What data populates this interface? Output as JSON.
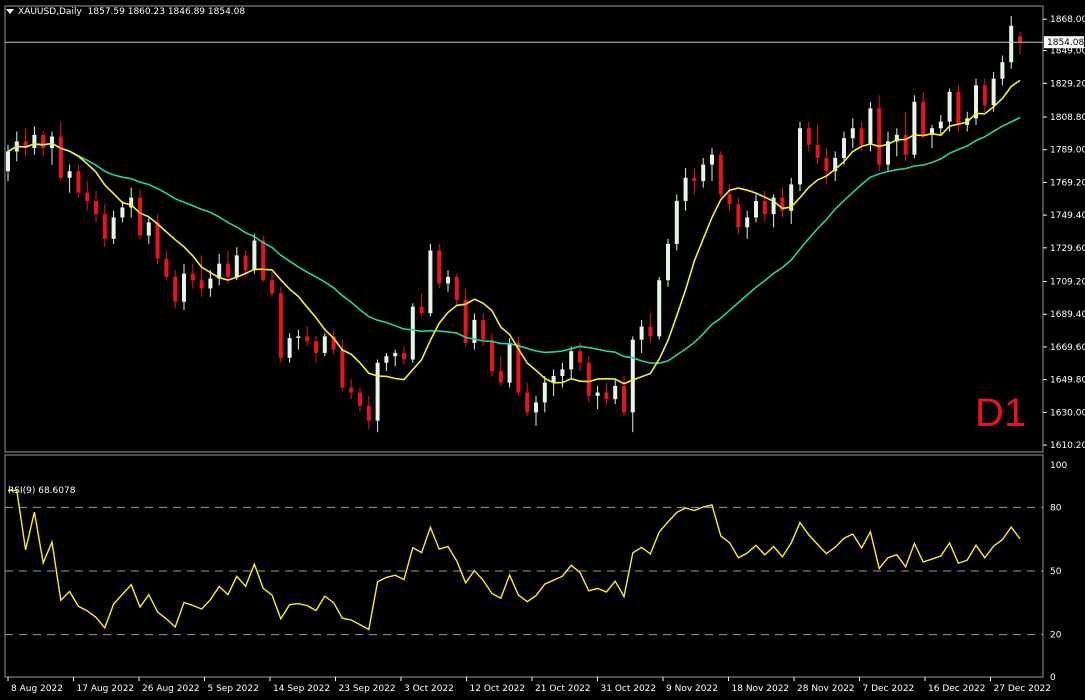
{
  "header": {
    "symbol": "XAUUSD,Daily",
    "ohlc": "1857.59 1860.23 1846.89 1854.08",
    "dropdown_icon": "triangle-down-icon"
  },
  "timeframe_badge": "D1",
  "rsi_header": "RSI(9) 68.6078",
  "colors": {
    "background": "#000000",
    "bull_candle": "#e6f5e6",
    "bear_candle": "#e8141c",
    "ma_fast": "#f5ee3a",
    "ma_slow": "#26d3a0",
    "rsi_line": "#ffeb2a",
    "grid": "#9a9a9a",
    "d1_text": "#e8141c"
  },
  "chart_data": [
    {
      "type": "candlestick",
      "symbol": "XAUUSD",
      "timeframe": "Daily",
      "y_ticks": [
        1868.0,
        1849.0,
        1829.2,
        1808.8,
        1789.0,
        1769.2,
        1749.4,
        1729.6,
        1709.2,
        1689.4,
        1669.6,
        1649.8,
        1630.0,
        1610.2
      ],
      "ylim": [
        1606,
        1876
      ],
      "current_price": 1854.08,
      "current_price_label": "1854.08",
      "x_labels": [
        "8 Aug 2022",
        "17 Aug 2022",
        "26 Aug 2022",
        "5 Sep 2022",
        "14 Sep 2022",
        "23 Sep 2022",
        "3 Oct 2022",
        "12 Oct 2022",
        "21 Oct 2022",
        "31 Oct 2022",
        "9 Nov 2022",
        "18 Nov 2022",
        "28 Nov 2022",
        "7 Dec 2022",
        "16 Dec 2022",
        "27 Dec 2022"
      ],
      "candles": [
        [
          1776,
          1792,
          1770,
          1788
        ],
        [
          1788,
          1800,
          1782,
          1794
        ],
        [
          1794,
          1802,
          1785,
          1790
        ],
        [
          1790,
          1803,
          1786,
          1798
        ],
        [
          1798,
          1800,
          1785,
          1790
        ],
        [
          1790,
          1800,
          1780,
          1797
        ],
        [
          1797,
          1806,
          1770,
          1772
        ],
        [
          1772,
          1780,
          1763,
          1776
        ],
        [
          1776,
          1780,
          1760,
          1763
        ],
        [
          1763,
          1770,
          1752,
          1758
        ],
        [
          1758,
          1764,
          1745,
          1750
        ],
        [
          1750,
          1756,
          1730,
          1735
        ],
        [
          1735,
          1752,
          1732,
          1748
        ],
        [
          1748,
          1758,
          1745,
          1754
        ],
        [
          1754,
          1766,
          1748,
          1760
        ],
        [
          1760,
          1765,
          1735,
          1737
        ],
        [
          1737,
          1748,
          1732,
          1745
        ],
        [
          1745,
          1750,
          1720,
          1723
        ],
        [
          1723,
          1728,
          1710,
          1712
        ],
        [
          1712,
          1716,
          1693,
          1697
        ],
        [
          1697,
          1720,
          1692,
          1714
        ],
        [
          1714,
          1720,
          1705,
          1710
        ],
        [
          1710,
          1725,
          1700,
          1705
        ],
        [
          1705,
          1716,
          1700,
          1711
        ],
        [
          1711,
          1726,
          1707,
          1720
        ],
        [
          1720,
          1728,
          1708,
          1712
        ],
        [
          1712,
          1730,
          1710,
          1725
        ],
        [
          1725,
          1728,
          1712,
          1716
        ],
        [
          1716,
          1738,
          1714,
          1734
        ],
        [
          1734,
          1737,
          1709,
          1710
        ],
        [
          1710,
          1715,
          1700,
          1702
        ],
        [
          1702,
          1706,
          1660,
          1663
        ],
        [
          1663,
          1678,
          1660,
          1675
        ],
        [
          1675,
          1680,
          1668,
          1676
        ],
        [
          1676,
          1682,
          1670,
          1673
        ],
        [
          1673,
          1676,
          1660,
          1666
        ],
        [
          1666,
          1678,
          1664,
          1676
        ],
        [
          1676,
          1680,
          1665,
          1668
        ],
        [
          1668,
          1674,
          1643,
          1645
        ],
        [
          1645,
          1650,
          1638,
          1642
        ],
        [
          1642,
          1645,
          1630,
          1634
        ],
        [
          1634,
          1640,
          1620,
          1625
        ],
        [
          1625,
          1662,
          1618,
          1660
        ],
        [
          1660,
          1666,
          1655,
          1664
        ],
        [
          1664,
          1668,
          1658,
          1666
        ],
        [
          1666,
          1670,
          1659,
          1662
        ],
        [
          1662,
          1696,
          1660,
          1694
        ],
        [
          1694,
          1702,
          1688,
          1690
        ],
        [
          1690,
          1732,
          1688,
          1728
        ],
        [
          1728,
          1732,
          1705,
          1708
        ],
        [
          1708,
          1716,
          1703,
          1712
        ],
        [
          1712,
          1714,
          1695,
          1698
        ],
        [
          1698,
          1705,
          1670,
          1672
        ],
        [
          1672,
          1690,
          1668,
          1686
        ],
        [
          1686,
          1690,
          1670,
          1674
        ],
        [
          1674,
          1678,
          1652,
          1655
        ],
        [
          1655,
          1664,
          1646,
          1648
        ],
        [
          1648,
          1675,
          1645,
          1672
        ],
        [
          1672,
          1676,
          1640,
          1642
        ],
        [
          1642,
          1648,
          1628,
          1630
        ],
        [
          1630,
          1640,
          1622,
          1636
        ],
        [
          1636,
          1652,
          1630,
          1648
        ],
        [
          1648,
          1656,
          1640,
          1652
        ],
        [
          1652,
          1660,
          1645,
          1656
        ],
        [
          1656,
          1670,
          1650,
          1667
        ],
        [
          1667,
          1672,
          1655,
          1660
        ],
        [
          1660,
          1664,
          1636,
          1640
        ],
        [
          1640,
          1646,
          1632,
          1642
        ],
        [
          1642,
          1648,
          1634,
          1638
        ],
        [
          1638,
          1650,
          1635,
          1646
        ],
        [
          1646,
          1652,
          1628,
          1630
        ],
        [
          1630,
          1676,
          1618,
          1674
        ],
        [
          1674,
          1686,
          1666,
          1682
        ],
        [
          1682,
          1690,
          1672,
          1676
        ],
        [
          1676,
          1712,
          1674,
          1710
        ],
        [
          1710,
          1735,
          1706,
          1732
        ],
        [
          1732,
          1762,
          1728,
          1758
        ],
        [
          1758,
          1778,
          1752,
          1772
        ],
        [
          1772,
          1778,
          1762,
          1770
        ],
        [
          1770,
          1784,
          1766,
          1780
        ],
        [
          1780,
          1790,
          1770,
          1786
        ],
        [
          1786,
          1788,
          1760,
          1762
        ],
        [
          1762,
          1768,
          1752,
          1756
        ],
        [
          1756,
          1760,
          1738,
          1742
        ],
        [
          1742,
          1752,
          1735,
          1748
        ],
        [
          1748,
          1762,
          1745,
          1758
        ],
        [
          1758,
          1764,
          1746,
          1750
        ],
        [
          1750,
          1762,
          1742,
          1760
        ],
        [
          1760,
          1766,
          1748,
          1752
        ],
        [
          1752,
          1772,
          1744,
          1768
        ],
        [
          1768,
          1806,
          1764,
          1802
        ],
        [
          1802,
          1806,
          1788,
          1792
        ],
        [
          1792,
          1804,
          1780,
          1784
        ],
        [
          1784,
          1790,
          1768,
          1776
        ],
        [
          1776,
          1788,
          1770,
          1784
        ],
        [
          1784,
          1800,
          1780,
          1796
        ],
        [
          1796,
          1808,
          1790,
          1802
        ],
        [
          1802,
          1806,
          1788,
          1792
        ],
        [
          1792,
          1818,
          1788,
          1814
        ],
        [
          1814,
          1822,
          1776,
          1780
        ],
        [
          1780,
          1800,
          1776,
          1794
        ],
        [
          1794,
          1802,
          1785,
          1798
        ],
        [
          1798,
          1812,
          1782,
          1786
        ],
        [
          1786,
          1822,
          1784,
          1818
        ],
        [
          1818,
          1824,
          1796,
          1798
        ],
        [
          1798,
          1804,
          1790,
          1802
        ],
        [
          1802,
          1810,
          1798,
          1806
        ],
        [
          1806,
          1826,
          1800,
          1824
        ],
        [
          1824,
          1828,
          1800,
          1804
        ],
        [
          1804,
          1812,
          1800,
          1808
        ],
        [
          1808,
          1832,
          1804,
          1828
        ],
        [
          1828,
          1832,
          1812,
          1816
        ],
        [
          1816,
          1836,
          1812,
          1832
        ],
        [
          1832,
          1846,
          1828,
          1842
        ],
        [
          1842,
          1870,
          1838,
          1864
        ],
        [
          1857.59,
          1860.23,
          1846.89,
          1854.08
        ]
      ],
      "series": [
        {
          "name": "MA fast",
          "values": []
        },
        {
          "name": "MA slow",
          "values": []
        }
      ]
    },
    {
      "type": "line",
      "title": "RSI(9) 68.6078",
      "y_ticks": [
        100,
        80,
        50,
        20,
        0
      ],
      "dashed_levels": [
        80,
        50,
        20
      ],
      "ylim": [
        0,
        100
      ]
    }
  ]
}
